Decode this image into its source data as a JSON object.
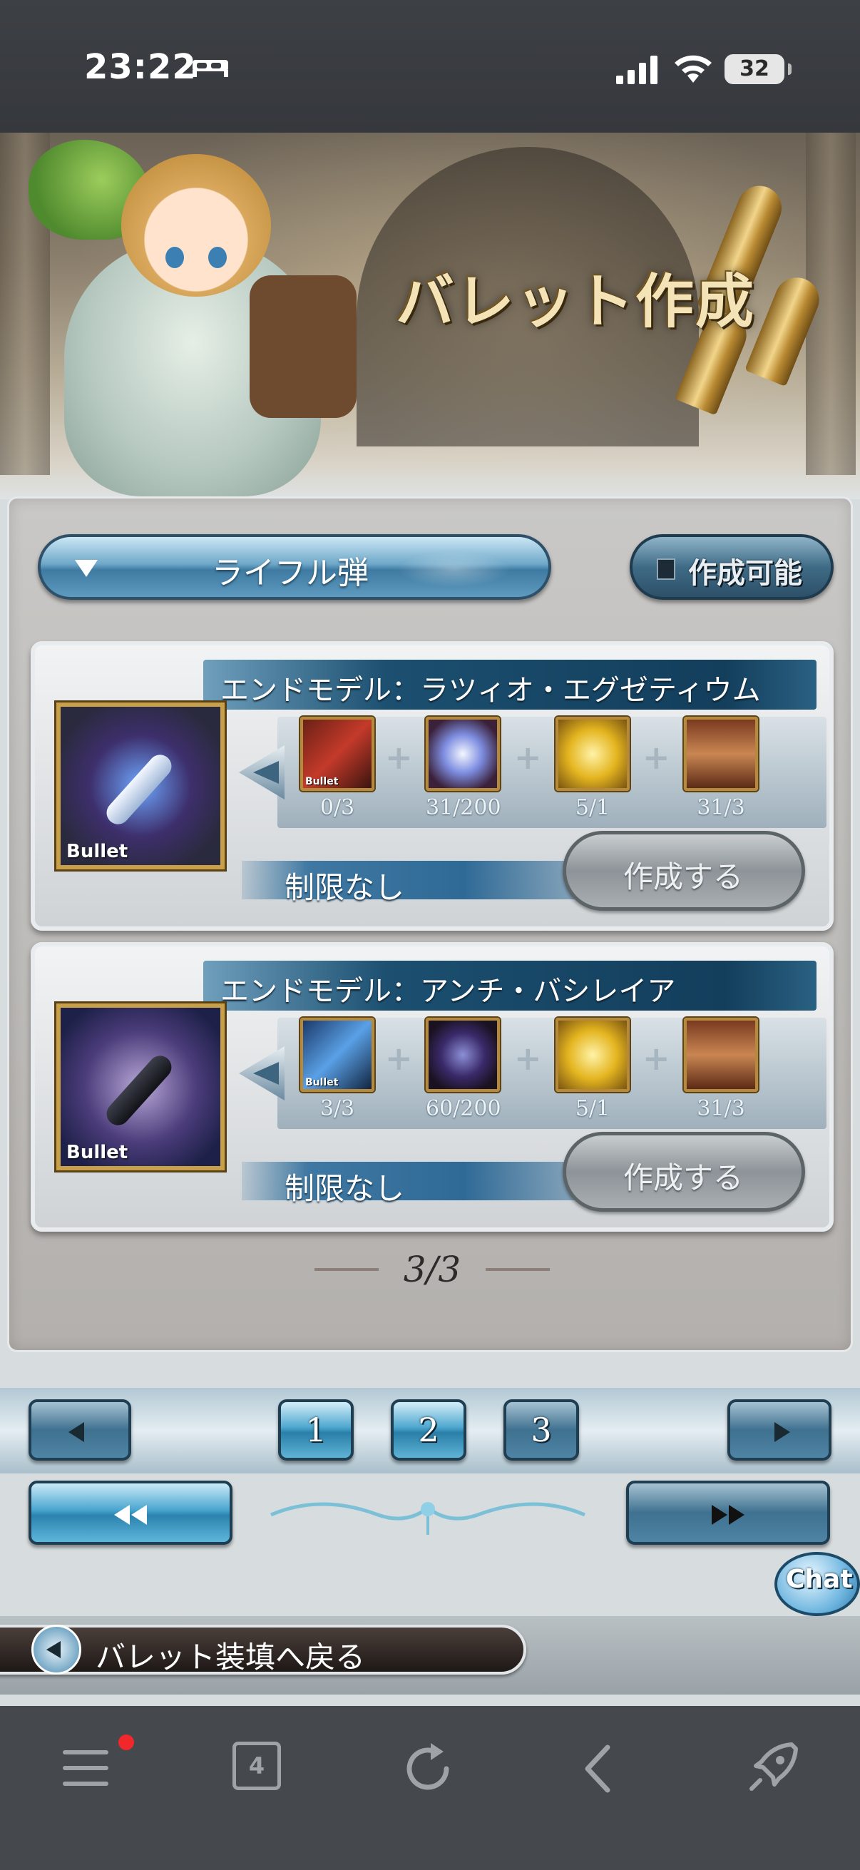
{
  "status_bar": {
    "time": "23:22",
    "battery": "32"
  },
  "banner": {
    "title": "バレット作成"
  },
  "filter": {
    "category": "ライフル弾",
    "toggle_label": "作成可能"
  },
  "cards": [
    {
      "name": "エンドモデル：ラツィオ・エグゼティウム",
      "icon_label": "Bullet",
      "materials": [
        {
          "icon": "red-bullet-icon",
          "label": "Bullet",
          "count": "0/3"
        },
        {
          "icon": "prism-orb-icon",
          "label": "",
          "count": "31/200"
        },
        {
          "icon": "gold-bar-icon",
          "label": "",
          "count": "5/1"
        },
        {
          "icon": "hourglass-icon",
          "label": "",
          "count": "31/3"
        }
      ],
      "limit": "制限なし",
      "make_label": "作成する"
    },
    {
      "name": "エンドモデル：アンチ・バシレイア",
      "icon_label": "Bullet",
      "materials": [
        {
          "icon": "blue-bullet-icon",
          "label": "Bullet",
          "count": "3/3"
        },
        {
          "icon": "dark-orb-icon",
          "label": "",
          "count": "60/200"
        },
        {
          "icon": "gold-bar-icon",
          "label": "",
          "count": "5/1"
        },
        {
          "icon": "hourglass-icon",
          "label": "",
          "count": "31/3"
        }
      ],
      "limit": "制限なし",
      "make_label": "作成する"
    }
  ],
  "pager": {
    "current": "3/3",
    "pages": [
      "1",
      "2",
      "3"
    ]
  },
  "chat_label": "Chat",
  "back_label": "バレット装填へ戻る",
  "browser": {
    "tab_count": "4"
  },
  "colors": {
    "accent_blue": "#2a7fa8",
    "header_navy": "#133e5c",
    "gold_border": "#c8a04a",
    "toolbar_bg": "#45494e",
    "notify_red": "#f0272b"
  }
}
